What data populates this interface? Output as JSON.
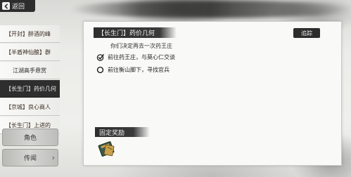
{
  "back_button": {
    "label": "返回"
  },
  "quest_list": [
    {
      "label": "【开封】醉酒的峰",
      "type": "main"
    },
    {
      "label": "【半盾神仙酿】群",
      "type": "main"
    },
    {
      "label": "江湖高手悬赏",
      "type": "sub"
    },
    {
      "label": "【长生门】药价几何",
      "type": "active"
    },
    {
      "label": "【京城】良心商人",
      "type": "main"
    },
    {
      "label": "【长生门】上进的",
      "type": "main"
    }
  ],
  "side_buttons": {
    "role": "角色",
    "tome": "传闻"
  },
  "quest": {
    "title": "【长生门】药价几何",
    "track_label": "追踪",
    "description": "你们决定再去一次药王庄",
    "tasks": [
      {
        "text": "前往药王庄，与莫心仁交谈",
        "status": "done",
        "icon": "check-icon"
      },
      {
        "text": "前往衡山脚下，寻找官兵",
        "status": "pending",
        "icon": "ring-icon"
      }
    ]
  },
  "reward": {
    "title": "固定奖励",
    "item_icon": "book-icon"
  }
}
